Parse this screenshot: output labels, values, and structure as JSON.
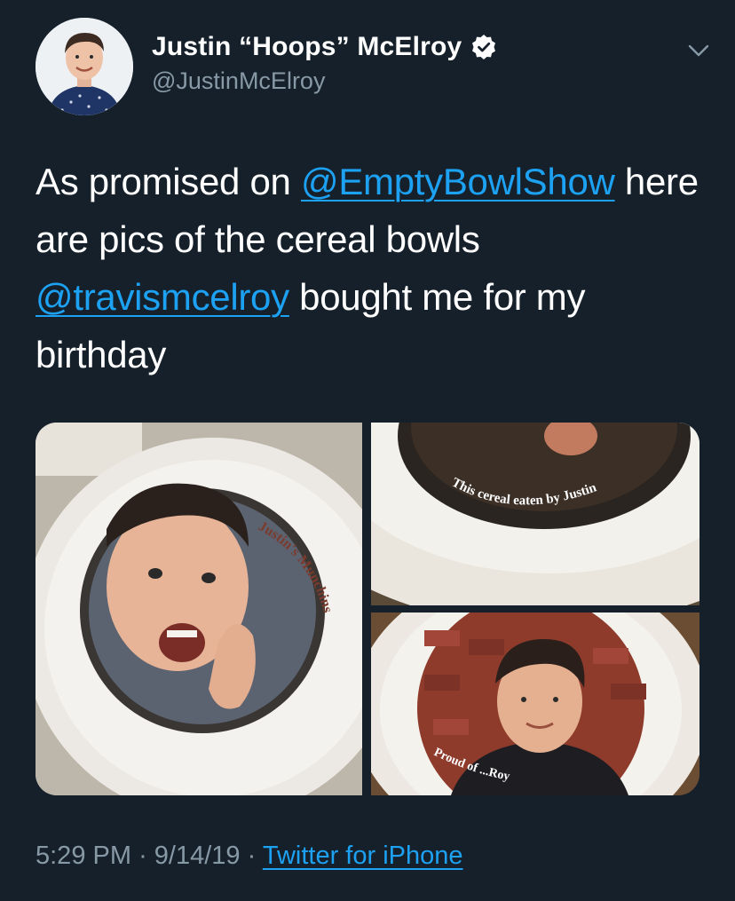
{
  "user": {
    "display_name": "Justin “Hoops” McElroy",
    "handle": "@JustinMcElroy",
    "verified": true
  },
  "tweet": {
    "text_1": "As promised on ",
    "mention_1": "@EmptyBowlShow",
    "text_2": " here are pics of the cereal bowls ",
    "mention_2": "@travismcelroy",
    "text_3": " bought me for my birthday"
  },
  "media": {
    "photo_count": 3,
    "bowl_1_text": "Justin's Munchins",
    "bowl_2_text": "This cereal eaten by Justin",
    "bowl_3_text": "Proud of ...Roy"
  },
  "meta": {
    "time": "5:29 PM",
    "date": "9/14/19",
    "source": "Twitter for iPhone",
    "separator": "·"
  },
  "colors": {
    "background": "#15202b",
    "link": "#1da1f2",
    "secondary": "#8899a6"
  },
  "icons": {
    "verified": "verified-badge-icon",
    "menu": "chevron-down-icon"
  }
}
